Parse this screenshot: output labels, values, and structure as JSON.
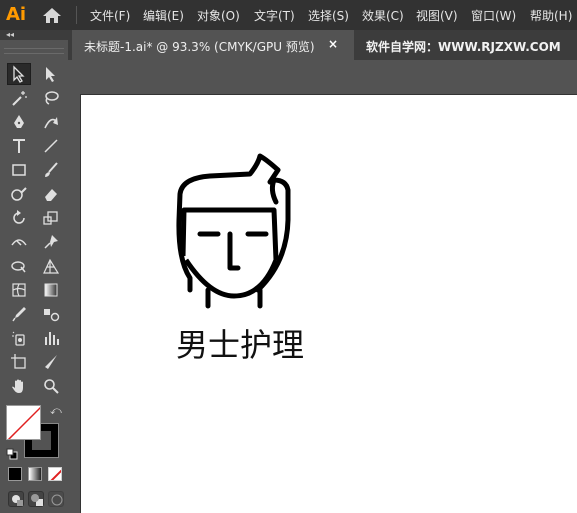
{
  "app": {
    "logo_text": "Ai",
    "brand_color": "#ff9a00"
  },
  "menubar": {
    "items": [
      {
        "label": "文件(F)"
      },
      {
        "label": "编辑(E)"
      },
      {
        "label": "对象(O)"
      },
      {
        "label": "文字(T)"
      },
      {
        "label": "选择(S)"
      },
      {
        "label": "效果(C)"
      },
      {
        "label": "视图(V)"
      },
      {
        "label": "窗口(W)"
      },
      {
        "label": "帮助(H)"
      }
    ]
  },
  "panel": {
    "collapse_label": "◂◂"
  },
  "tabs": {
    "active_document": "未标题-1.ai* @ 93.3% (CMYK/GPU 预览)",
    "close_glyph": "×",
    "watermark": "软件自学网：WWW.RJZXW.COM"
  },
  "tools": [
    {
      "name": "selection-tool-icon",
      "active": true
    },
    {
      "name": "direct-selection-tool-icon"
    },
    {
      "name": "magic-wand-tool-icon"
    },
    {
      "name": "lasso-tool-icon"
    },
    {
      "name": "pen-tool-icon"
    },
    {
      "name": "curvature-tool-icon"
    },
    {
      "name": "type-tool-icon"
    },
    {
      "name": "line-segment-tool-icon"
    },
    {
      "name": "rectangle-tool-icon"
    },
    {
      "name": "paintbrush-tool-icon"
    },
    {
      "name": "shaper-tool-icon"
    },
    {
      "name": "eraser-tool-icon"
    },
    {
      "name": "rotate-tool-icon"
    },
    {
      "name": "scale-tool-icon"
    },
    {
      "name": "width-tool-icon"
    },
    {
      "name": "puppet-warp-tool-icon"
    },
    {
      "name": "shape-builder-tool-icon"
    },
    {
      "name": "perspective-grid-tool-icon"
    },
    {
      "name": "mesh-tool-icon"
    },
    {
      "name": "gradient-tool-icon"
    },
    {
      "name": "eyedropper-tool-icon"
    },
    {
      "name": "blend-tool-icon"
    },
    {
      "name": "symbol-sprayer-tool-icon"
    },
    {
      "name": "column-graph-tool-icon"
    },
    {
      "name": "artboard-tool-icon"
    },
    {
      "name": "slice-tool-icon"
    },
    {
      "name": "hand-tool-icon"
    },
    {
      "name": "zoom-tool-icon"
    }
  ],
  "swatches": {
    "fill_color": "#ffffff",
    "stroke_color": "#000000",
    "swap_glyph": "⤺"
  },
  "artwork": {
    "caption": "男士护理",
    "stroke_color": "#000000"
  }
}
